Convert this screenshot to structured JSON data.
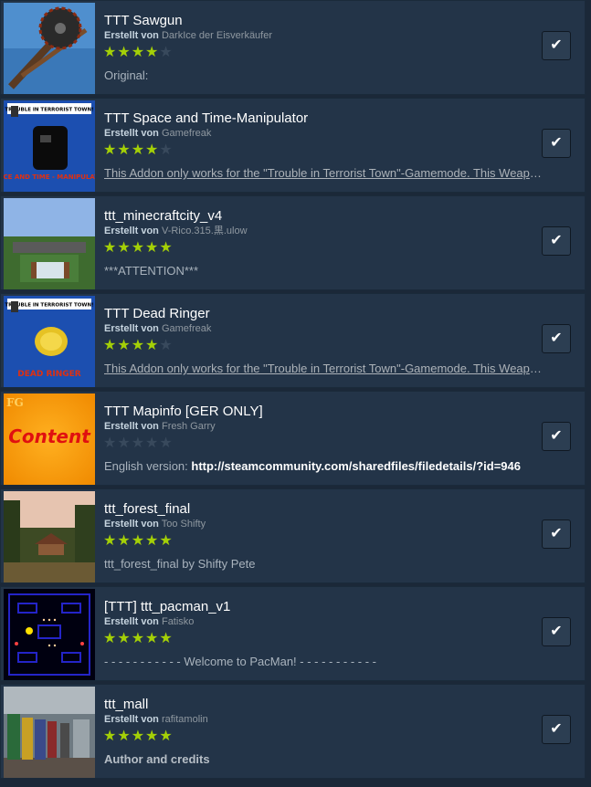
{
  "items": [
    {
      "title": "TTT Sawgun",
      "by": "Erstellt von",
      "author": "DarkIce der Eisverkäufer",
      "stars_on": "★★★★",
      "stars_off": "★",
      "desc": "Original:",
      "check_icon": "checkmark-icon"
    },
    {
      "title": "TTT Space and Time-Manipulator",
      "by": "Erstellt von",
      "author": "Gamefreak",
      "stars_on": "★★★★",
      "stars_off": "★",
      "desc": "This Addon only works for the \"Trouble in Terrorist Town\"-Gamemode. This Weapon allows you to manipulate Space and Time",
      "thumb_banner": "TROUBLE IN TERRORIST TOWN!",
      "thumb_caption": "SPACE AND TIME - MANIPULATOR",
      "check_icon": "checkmark-icon"
    },
    {
      "title": "ttt_minecraftcity_v4",
      "by": "Erstellt von",
      "author": "V-Rico.315.黒.ulow",
      "stars_on": "★★★★★",
      "stars_off": "",
      "desc": "***ATTENTION***",
      "check_icon": "checkmark-icon"
    },
    {
      "title": "TTT Dead Ringer",
      "by": "Erstellt von",
      "author": "Gamefreak",
      "stars_on": "★★★★",
      "stars_off": "★",
      "desc": "This Addon only works for the \"Trouble in Terrorist Town\"-Gamemode. This Weapon allows you to fake your death",
      "thumb_banner": "TROUBLE IN TERRORIST TOWN!",
      "thumb_caption": "DEAD RINGER",
      "check_icon": "checkmark-icon"
    },
    {
      "title": "TTT Mapinfo [GER ONLY]",
      "by": "Erstellt von",
      "author": "Fresh Garry",
      "stars_on": "",
      "stars_off": "★★★★★",
      "desc_prefix": "English version: ",
      "desc_url": "http://steamcommunity.com/sharedfiles/filedetails/?id=946",
      "thumb_tag": "FG",
      "thumb_word": "Content",
      "check_icon": "checkmark-icon"
    },
    {
      "title": "ttt_forest_final",
      "by": "Erstellt von",
      "author": "Too Shifty",
      "stars_on": "★★★★★",
      "stars_off": "",
      "desc": "ttt_forest_final by Shifty Pete",
      "check_icon": "checkmark-icon"
    },
    {
      "title": "[TTT] ttt_pacman_v1",
      "by": "Erstellt von",
      "author": "Fatisko",
      "stars_on": "★★★★★",
      "stars_off": "",
      "desc": "- - - - - - - - - - - Welcome to PacMan! - - - - - - - - - - -",
      "check_icon": "checkmark-icon"
    },
    {
      "title": "ttt_mall",
      "by": "Erstellt von",
      "author": "rafitamolin",
      "stars_on": "★★★★★",
      "stars_off": "",
      "desc": "Author and credits",
      "check_icon": "checkmark-icon"
    }
  ],
  "colors": {
    "background": "#1b2838",
    "row": "#233448",
    "star_on": "#a4d007",
    "star_off": "#38495c",
    "title": "#ffffff"
  }
}
